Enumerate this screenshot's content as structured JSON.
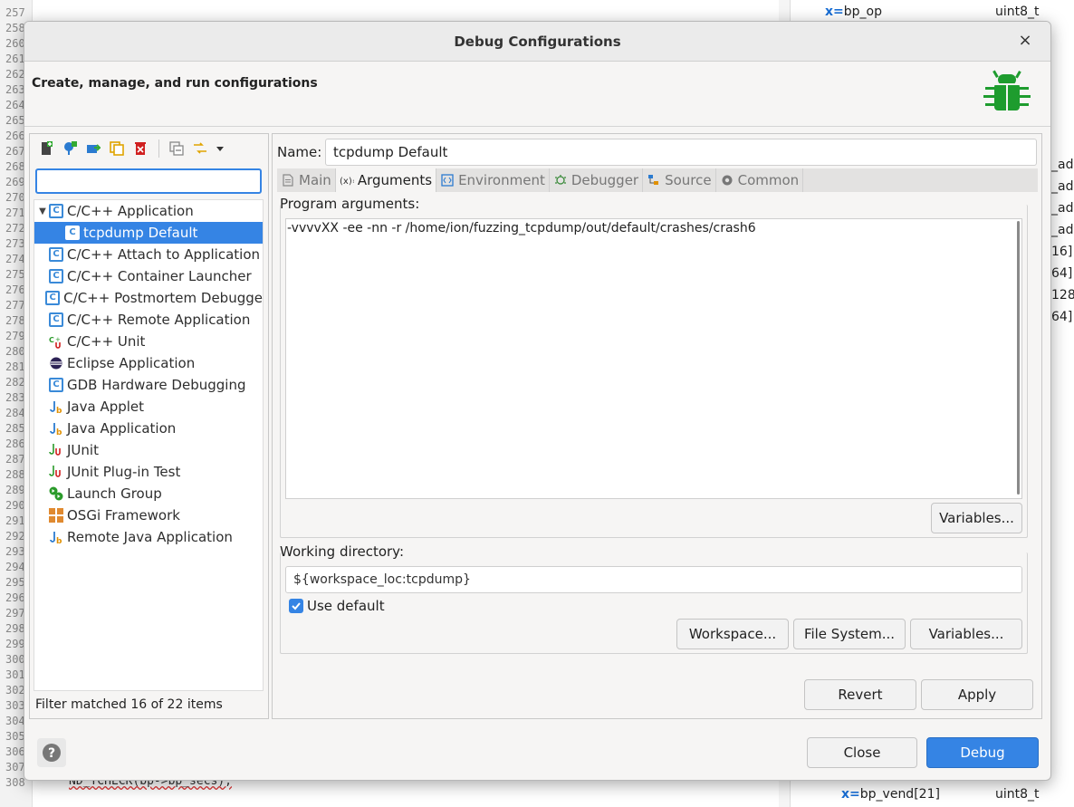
{
  "background": {
    "line_numbers": [
      "257",
      "258",
      "260",
      "261",
      "262",
      "263",
      "264",
      "265",
      "266",
      "267",
      "268",
      "269",
      "270",
      "271",
      "272",
      "273",
      "274",
      "275",
      "276",
      "277",
      "278",
      "279",
      "280",
      "281",
      "282",
      "283",
      "284",
      "285",
      "286",
      "287",
      "288",
      "289",
      "290",
      "291",
      "292",
      "293",
      "294",
      "295",
      "296",
      "297",
      "298",
      "299",
      "300",
      "301",
      "302",
      "303",
      "304",
      "305",
      "306",
      "307",
      "308"
    ],
    "code_bottom": "ND_TCHECK(bp->bp_secs);",
    "vars": [
      {
        "name": "bp_op",
        "type": "uint8_t"
      },
      {
        "name": "bp_vend[21]",
        "type": "uint8_t"
      }
    ],
    "side_fragments": [
      "_add",
      "_add",
      "_add",
      "_add",
      "16]",
      "64]",
      "128",
      "64]"
    ]
  },
  "dialog": {
    "title": "Debug Configurations",
    "close_glyph": "×",
    "subtitle": "Create, manage, and run configurations",
    "bug_color": "#1e9c2e"
  },
  "left": {
    "filter_value": "",
    "tree": [
      {
        "label": "C/C++ Application",
        "icon": "c-app-icon",
        "level": 0,
        "expanded": true
      },
      {
        "label": "tcpdump Default",
        "icon": "c-app-icon",
        "level": 1,
        "selected": true
      },
      {
        "label": "C/C++ Attach to Application",
        "icon": "c-app-icon",
        "level": 0
      },
      {
        "label": "C/C++ Container Launcher",
        "icon": "c-app-icon",
        "level": 0
      },
      {
        "label": "C/C++ Postmortem Debugge",
        "icon": "c-app-icon",
        "level": 0
      },
      {
        "label": "C/C++ Remote Application",
        "icon": "c-app-icon",
        "level": 0
      },
      {
        "label": "C/C++ Unit",
        "icon": "c-unit-icon",
        "level": 0
      },
      {
        "label": "Eclipse Application",
        "icon": "eclipse-icon",
        "level": 0
      },
      {
        "label": "GDB Hardware Debugging",
        "icon": "c-app-icon",
        "level": 0
      },
      {
        "label": "Java Applet",
        "icon": "java-icon",
        "level": 0
      },
      {
        "label": "Java Application",
        "icon": "java-icon",
        "level": 0
      },
      {
        "label": "JUnit",
        "icon": "junit-icon",
        "level": 0
      },
      {
        "label": "JUnit Plug-in Test",
        "icon": "junit-icon",
        "level": 0
      },
      {
        "label": "Launch Group",
        "icon": "launch-group-icon",
        "level": 0
      },
      {
        "label": "OSGi Framework",
        "icon": "osgi-icon",
        "level": 0
      },
      {
        "label": "Remote Java Application",
        "icon": "java-icon",
        "level": 0
      }
    ],
    "filter_status": "Filter matched 16 of 22 items"
  },
  "right": {
    "name_label": "Name:",
    "name_value": "tcpdump Default",
    "tabs": [
      {
        "label": "Main",
        "icon": "main-tab-icon",
        "active": false
      },
      {
        "label": "Arguments",
        "icon": "arguments-tab-icon",
        "active": true
      },
      {
        "label": "Environment",
        "icon": "environment-tab-icon",
        "active": false
      },
      {
        "label": "Debugger",
        "icon": "debugger-tab-icon",
        "active": false
      },
      {
        "label": "Source",
        "icon": "source-tab-icon",
        "active": false
      },
      {
        "label": "Common",
        "icon": "common-tab-icon",
        "active": false
      }
    ],
    "program_args_label": "Program arguments:",
    "program_args_value": "-vvvvXX -ee -nn -r /home/ion/fuzzing_tcpdump/out/default/crashes/crash6",
    "variables_label": "Variables...",
    "working_dir_label": "Working directory:",
    "working_dir_value": "${workspace_loc:tcpdump}",
    "use_default_label": "Use default",
    "use_default_checked": true,
    "workspace_btn": "Workspace...",
    "filesystem_btn": "File System...",
    "variables2_btn": "Variables...",
    "revert_btn": "Revert",
    "apply_btn": "Apply"
  },
  "footer": {
    "close_btn": "Close",
    "debug_btn": "Debug",
    "help_glyph": "?"
  }
}
